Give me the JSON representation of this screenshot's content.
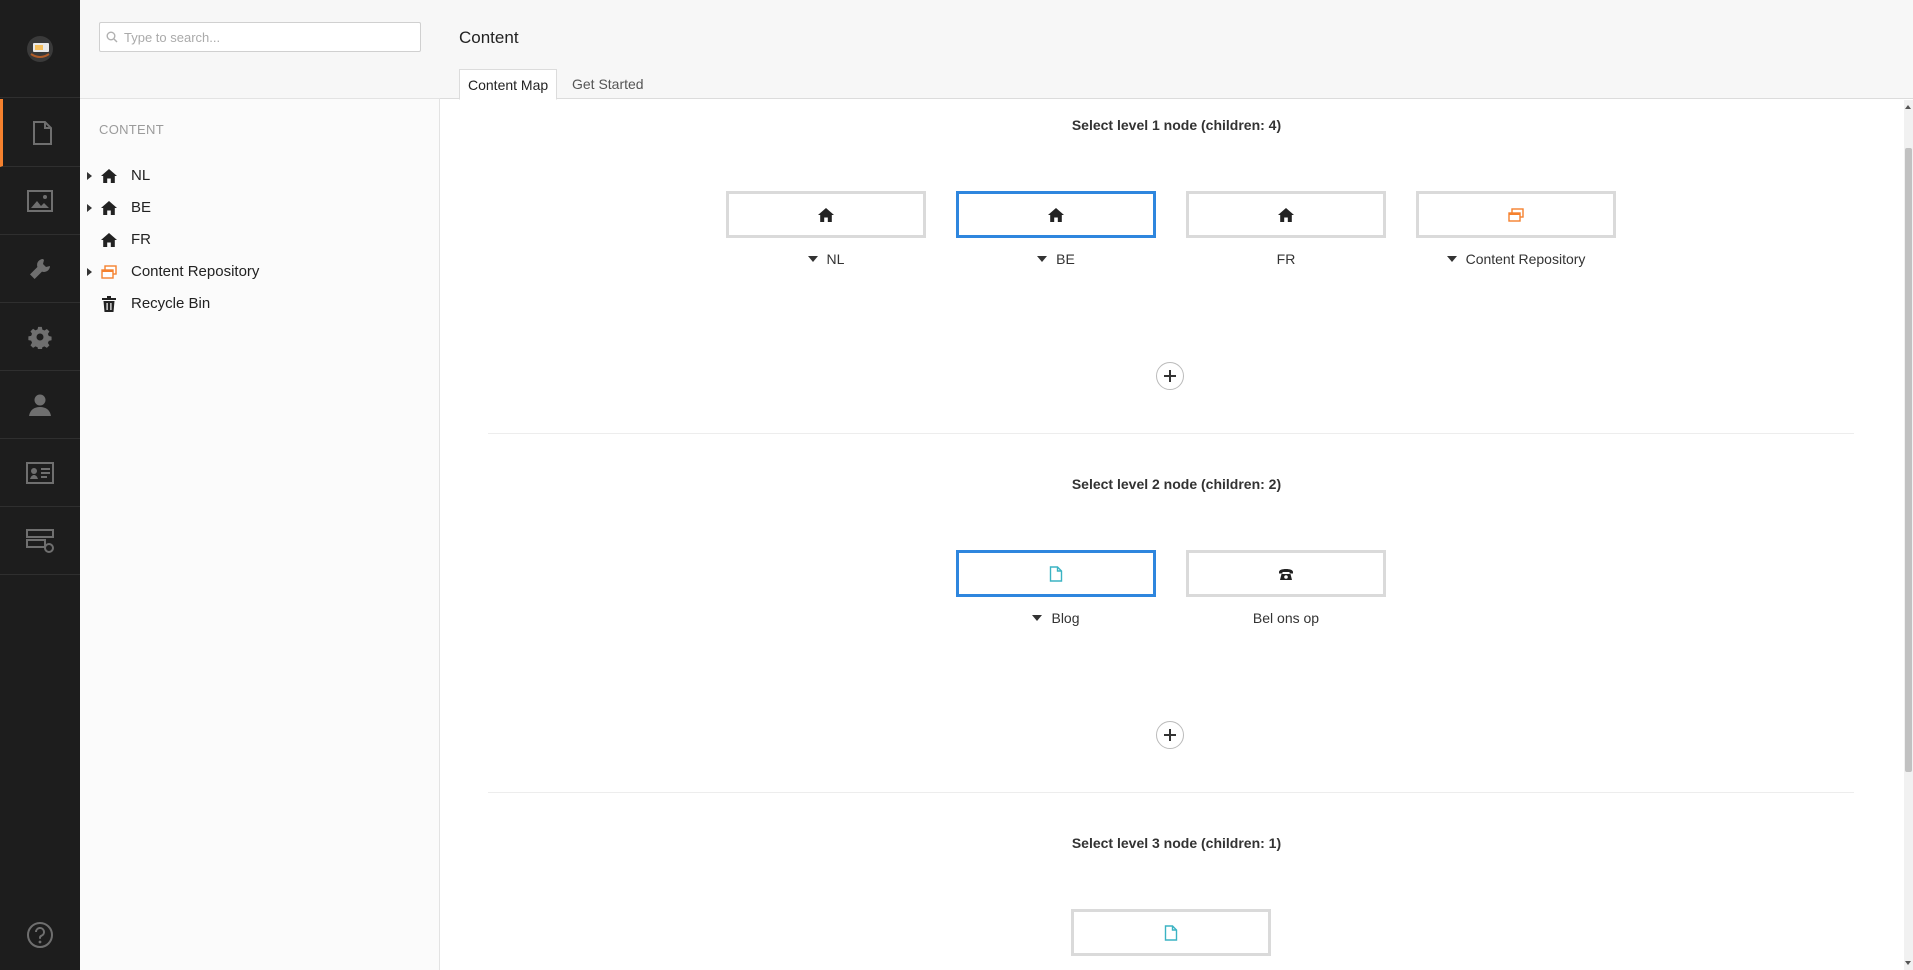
{
  "app": {
    "logo_icon": "umbraco-logo-icon"
  },
  "iconbar": {
    "items": [
      {
        "name": "content-icon",
        "active": true
      },
      {
        "name": "media-icon",
        "active": false
      },
      {
        "name": "settings-wrench-icon",
        "active": false
      },
      {
        "name": "developer-gear-icon",
        "active": false
      },
      {
        "name": "users-icon",
        "active": false
      },
      {
        "name": "members-card-icon",
        "active": false
      },
      {
        "name": "forms-icon",
        "active": false
      }
    ],
    "help_icon": "help-icon"
  },
  "tree": {
    "search_placeholder": "Type to search...",
    "heading": "CONTENT",
    "items": [
      {
        "label": "NL",
        "icon": "home-icon",
        "expandable": true
      },
      {
        "label": "BE",
        "icon": "home-icon",
        "expandable": true
      },
      {
        "label": "FR",
        "icon": "home-icon",
        "expandable": false
      },
      {
        "label": "Content Repository",
        "icon": "repository-icon",
        "expandable": true
      },
      {
        "label": "Recycle Bin",
        "icon": "trash-icon",
        "expandable": false
      }
    ]
  },
  "main": {
    "title": "Content",
    "tabs": [
      {
        "label": "Content Map",
        "active": true
      },
      {
        "label": "Get Started",
        "active": false
      }
    ],
    "levels": [
      {
        "title": "Select level 1 node (children: 4)",
        "nodes": [
          {
            "label": "NL",
            "icon": "home-icon",
            "has_children": true,
            "selected": false
          },
          {
            "label": "BE",
            "icon": "home-icon",
            "has_children": true,
            "selected": true
          },
          {
            "label": "FR",
            "icon": "home-icon",
            "has_children": false,
            "selected": false
          },
          {
            "label": "Content Repository",
            "icon": "repository-icon",
            "has_children": true,
            "selected": false
          }
        ]
      },
      {
        "title": "Select level 2 node (children: 2)",
        "nodes": [
          {
            "label": "Blog",
            "icon": "document-icon",
            "has_children": true,
            "selected": true
          },
          {
            "label": "Bel ons op",
            "icon": "phone-icon",
            "has_children": false,
            "selected": false
          }
        ]
      },
      {
        "title": "Select level 3 node (children: 1)",
        "nodes": [
          {
            "label": "",
            "icon": "document-icon",
            "has_children": false,
            "selected": false
          }
        ]
      }
    ]
  },
  "colors": {
    "accent": "#f5812e",
    "selected_border": "#2e86de",
    "document_icon": "#3bb3c3",
    "sidebar_bg": "#1d1d1d"
  }
}
